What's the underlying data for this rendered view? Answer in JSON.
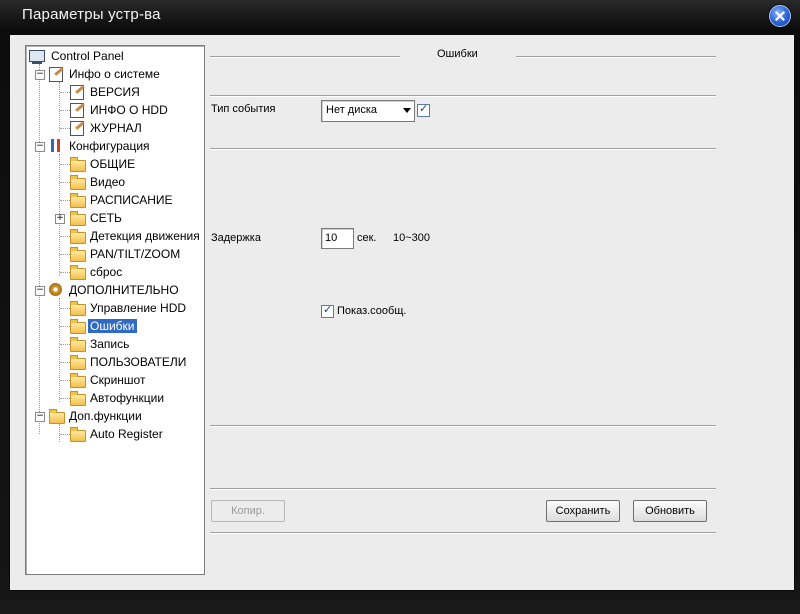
{
  "window": {
    "title": "Параметры устр-ва"
  },
  "tree": {
    "root": "Control Panel",
    "system_info": {
      "label": "Инфо о системе",
      "children": [
        "ВЕРСИЯ",
        "ИНФО О HDD",
        "ЖУРНАЛ"
      ]
    },
    "config": {
      "label": "Конфигурация",
      "children": [
        "ОБЩИЕ",
        "Видео",
        "РАСПИСАНИЕ",
        "СЕТЬ",
        "Детекция движения",
        "PAN/TILT/ZOOM",
        "сброс"
      ]
    },
    "advanced": {
      "label": "ДОПОЛНИТЕЛЬНО",
      "children": [
        "Управление HDD",
        "Ошибки",
        "Запись",
        "ПОЛЬЗОВАТЕЛИ",
        "Скриншот",
        "Автофункции"
      ]
    },
    "extra": {
      "label": "Доп.функции",
      "children": [
        "Auto Register"
      ]
    },
    "selected": "Ошибки"
  },
  "panel": {
    "section_title": "Ошибки",
    "event_type_label": "Тип события",
    "event_type_value": "Нет диска",
    "event_enabled": true,
    "delay_label": "Задержка",
    "delay_value": "10",
    "delay_unit": "сек.",
    "delay_range": "10~300",
    "show_message_label": "Показ.сообщ.",
    "show_message_checked": true
  },
  "buttons": {
    "copy": "Копир.",
    "save": "Сохранить",
    "refresh": "Обновить"
  }
}
